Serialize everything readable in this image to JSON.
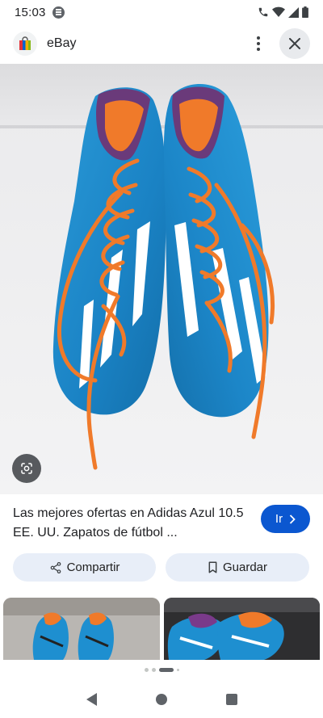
{
  "status": {
    "time": "15:03"
  },
  "header": {
    "site_name": "eBay"
  },
  "result": {
    "title": "Las mejores ofertas en Adidas Azul 10.5 EE. UU. Zapatos de fútbol ...",
    "go_label": "Ir"
  },
  "actions": {
    "share_label": "Compartir",
    "save_label": "Guardar"
  },
  "icons": {
    "notification": "chat-bubble-icon",
    "call": "call-icon",
    "wifi": "wifi-icon",
    "signal": "signal-icon",
    "battery": "battery-icon",
    "site": "ebay-shopping-bag-icon",
    "menu": "more-vert-icon",
    "close": "close-icon",
    "lens": "google-lens-icon",
    "go": "arrow-right-icon",
    "share": "share-icon",
    "save": "bookmark-icon"
  },
  "colors": {
    "accent": "#0b57d0",
    "action_bg": "#e8eef8",
    "shoe_blue": "#1e8fd0",
    "lace_orange": "#f07a2a"
  },
  "pager": {
    "count": 4,
    "active_index": 2
  }
}
